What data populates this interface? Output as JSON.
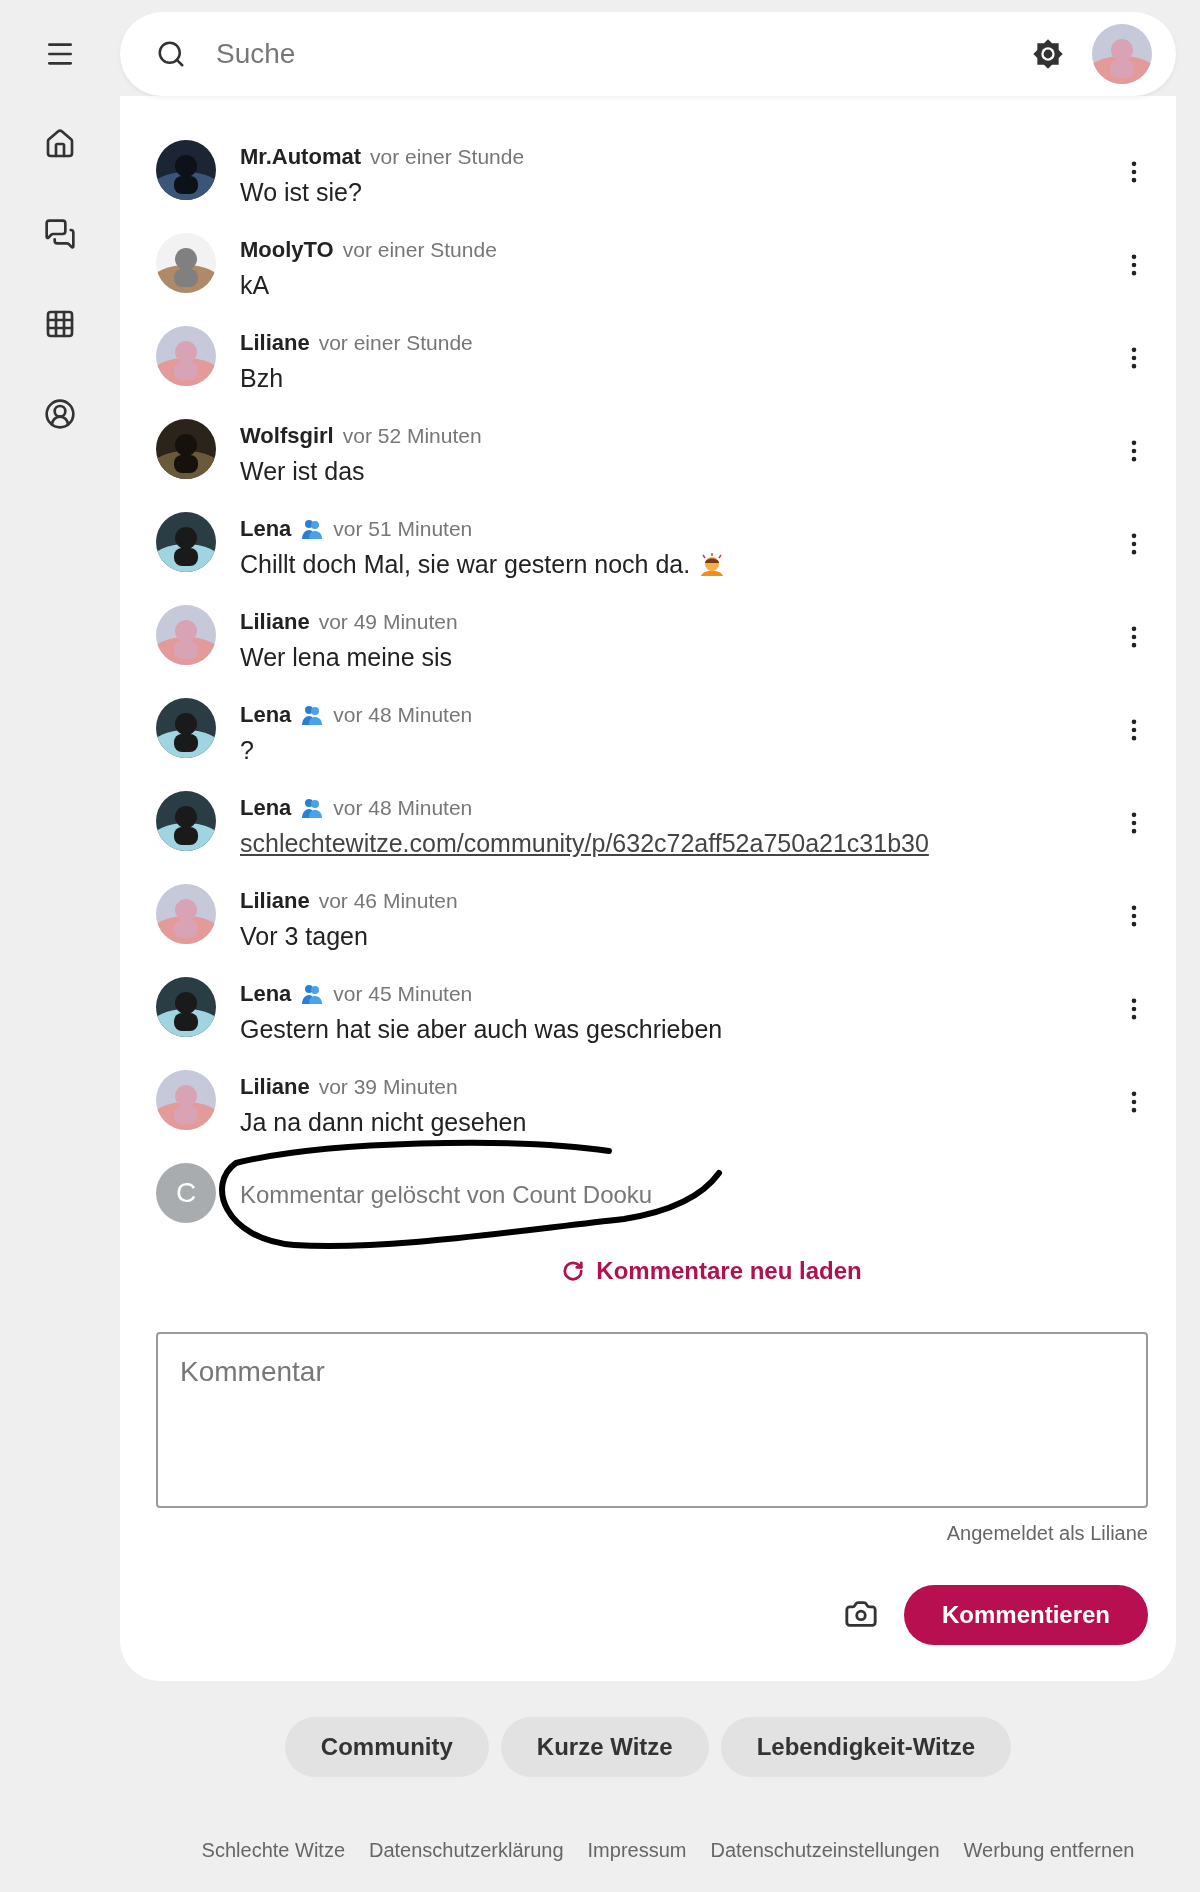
{
  "search": {
    "placeholder": "Suche"
  },
  "comments": [
    {
      "kind": "text",
      "author": "Mr.Automat",
      "badge": false,
      "time": "vor einer Stunde",
      "text": "Wo ist sie?",
      "emoji": false
    },
    {
      "kind": "text",
      "author": "MoolyTO",
      "badge": false,
      "time": "vor einer Stunde",
      "text": "kA",
      "emoji": false
    },
    {
      "kind": "text",
      "author": "Liliane",
      "badge": false,
      "time": "vor einer Stunde",
      "text": "Bzh",
      "emoji": false
    },
    {
      "kind": "text",
      "author": "Wolfsgirl",
      "badge": false,
      "time": "vor 52 Minuten",
      "text": "Wer ist das",
      "emoji": false
    },
    {
      "kind": "text",
      "author": "Lena",
      "badge": true,
      "time": "vor 51 Minuten",
      "text": "Chillt doch Mal, sie war gestern noch da.",
      "emoji": true
    },
    {
      "kind": "text",
      "author": "Liliane",
      "badge": false,
      "time": "vor 49 Minuten",
      "text": "Wer lena meine sis",
      "emoji": false
    },
    {
      "kind": "text",
      "author": "Lena",
      "badge": true,
      "time": "vor 48 Minuten",
      "text": "?",
      "emoji": false
    },
    {
      "kind": "link",
      "author": "Lena",
      "badge": true,
      "time": "vor 48 Minuten",
      "text": "schlechtewitze.com/community/p/632c72aff52a750a21c31b30",
      "emoji": false
    },
    {
      "kind": "text",
      "author": "Liliane",
      "badge": false,
      "time": "vor 46 Minuten",
      "text": "Vor 3 tagen",
      "emoji": false
    },
    {
      "kind": "text",
      "author": "Lena",
      "badge": true,
      "time": "vor 45 Minuten",
      "text": "Gestern hat sie aber auch was geschrieben",
      "emoji": false
    },
    {
      "kind": "text",
      "author": "Liliane",
      "badge": false,
      "time": "vor 39 Minuten",
      "text": "Ja na dann nicht gesehen",
      "emoji": false
    },
    {
      "kind": "deleted",
      "avatar_letter": "C",
      "text": "Kommentar gelöscht von Count Dooku",
      "scribbled": true
    }
  ],
  "reload": "Kommentare neu laden",
  "comment_field": {
    "placeholder": "Kommentar"
  },
  "signed_in": "Angemeldet als Liliane",
  "submit": "Kommentieren",
  "chips": [
    "Community",
    "Kurze Witze",
    "Lebendigkeit-Witze"
  ],
  "footer_links": [
    "Schlechte Witze",
    "Datenschutzerklärung",
    "Impressum",
    "Datenschutzeinstellungen",
    "Werbung entfernen"
  ]
}
